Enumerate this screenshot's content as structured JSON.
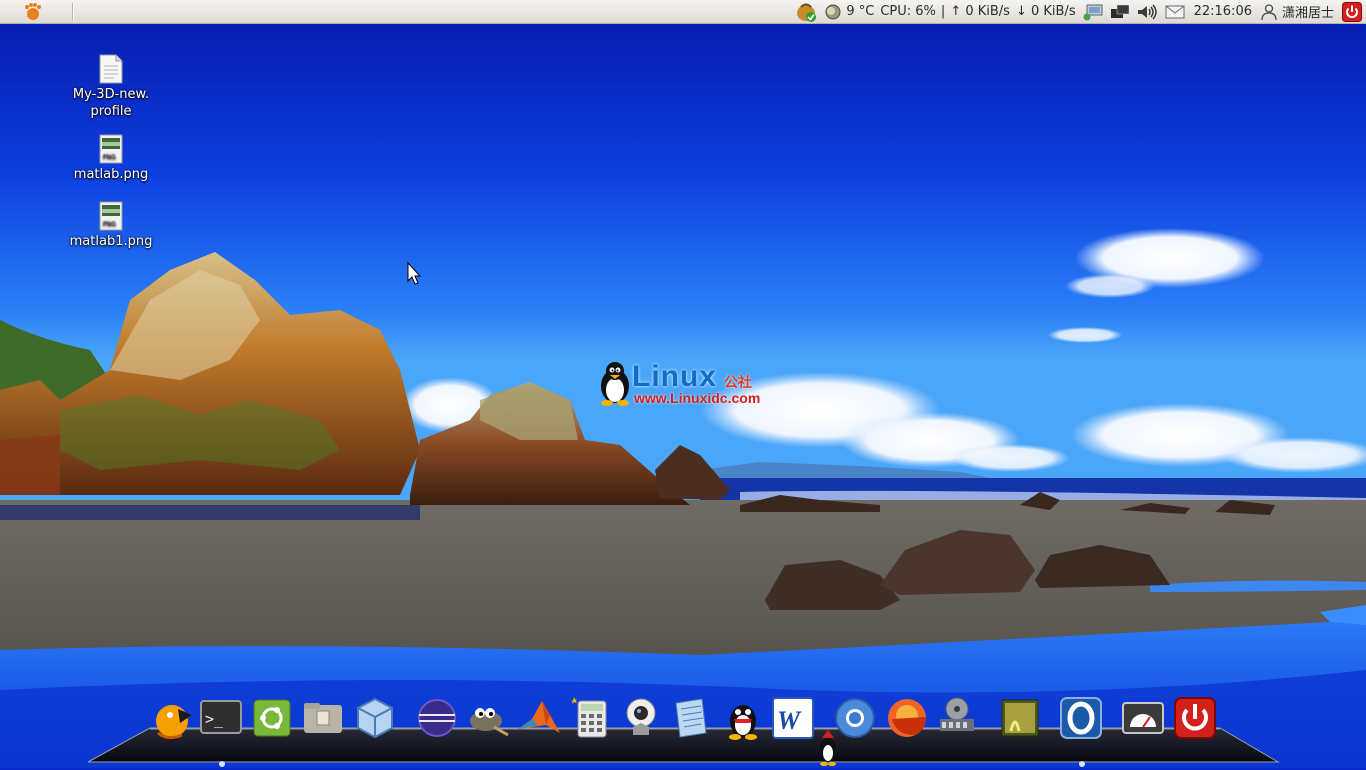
{
  "panel": {
    "weather": "9 °C",
    "cpu": "CPU: 6%",
    "sep": "|",
    "net_up": "↑ 0 KiB/s",
    "net_down": "↓ 0 KiB/s",
    "clock": "22:16:06",
    "user": "潇湘居士"
  },
  "desktop": {
    "icons": [
      {
        "label_line1": "My-3D-new.",
        "label_line2": "profile",
        "type": "text-file"
      },
      {
        "label_line1": "matlab.png",
        "type": "png-image"
      },
      {
        "label_line1": "matlab1.png",
        "type": "png-image"
      }
    ]
  },
  "watermark": {
    "brand": "Linux",
    "brand_cn": "公社",
    "url": "www.Linuxidc.com"
  },
  "dock": {
    "items": [
      "pidgin-icon",
      "terminal-icon",
      "ubuntu-software-icon",
      "files-icon",
      "virtualbox-icon",
      "eclipse-icon",
      "gimp-icon",
      "matlab-icon",
      "calculator-icon",
      "webcam-icon",
      "text-editor-icon",
      "qq-icon",
      "wps-writer-icon",
      "chromium-icon",
      "firefox-icon",
      "movie-player-icon",
      "image-viewer-icon",
      "opera-icon",
      "system-monitor-icon",
      "shutdown-icon"
    ]
  },
  "colors": {
    "sky_top": "#0a1fb8",
    "sky_mid": "#1c6ff0",
    "panel_bg": "#e6e3de",
    "shutdown_red": "#d4201c"
  }
}
